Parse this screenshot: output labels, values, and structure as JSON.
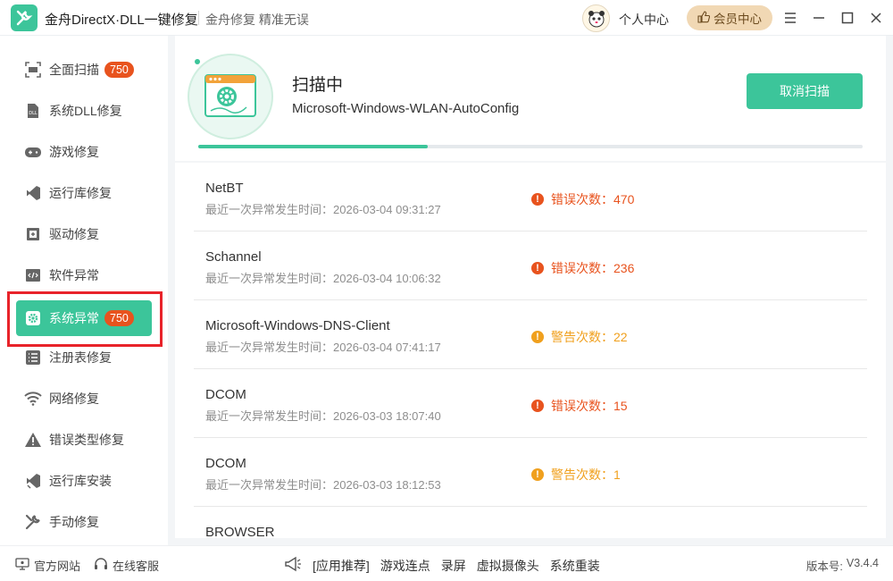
{
  "titlebar": {
    "app_title": "金舟DirectX·DLL一键修复",
    "slogan": "金舟修复 精准无误",
    "personal_center": "个人中心",
    "vip_center": "会员中心"
  },
  "sidebar": {
    "items": [
      {
        "label": "全面扫描",
        "badge": "750",
        "icon": "scan-icon"
      },
      {
        "label": "系统DLL修复",
        "badge": "",
        "icon": "dll-icon"
      },
      {
        "label": "游戏修复",
        "badge": "",
        "icon": "gamepad-icon"
      },
      {
        "label": "运行库修复",
        "badge": "",
        "icon": "runtime-icon"
      },
      {
        "label": "驱动修复",
        "badge": "",
        "icon": "driver-icon"
      },
      {
        "label": "软件异常",
        "badge": "",
        "icon": "code-icon"
      },
      {
        "label": "系统异常",
        "badge": "750",
        "icon": "gear-icon"
      },
      {
        "label": "注册表修复",
        "badge": "",
        "icon": "list-icon"
      },
      {
        "label": "网络修复",
        "badge": "",
        "icon": "wifi-icon"
      },
      {
        "label": "错误类型修复",
        "badge": "",
        "icon": "warning-icon"
      },
      {
        "label": "运行库安装",
        "badge": "",
        "icon": "install-icon"
      },
      {
        "label": "手动修复",
        "badge": "",
        "icon": "tools-icon"
      }
    ]
  },
  "scan": {
    "title": "扫描中",
    "current_item": "Microsoft-Windows-WLAN-AutoConfig",
    "cancel_label": "取消扫描",
    "progress": 0.345
  },
  "events": [
    {
      "name": "NetBT",
      "time": "最近一次异常发生时间：2026-03-04 09:31:27",
      "status": "错误次数：470",
      "type": "error"
    },
    {
      "name": "Schannel",
      "time": "最近一次异常发生时间：2026-03-04 10:06:32",
      "status": "错误次数：236",
      "type": "error"
    },
    {
      "name": "Microsoft-Windows-DNS-Client",
      "time": "最近一次异常发生时间：2026-03-04 07:41:17",
      "status": "警告次数：22",
      "type": "warning"
    },
    {
      "name": "DCOM",
      "time": "最近一次异常发生时间：2026-03-03 18:07:40",
      "status": "错误次数：15",
      "type": "error"
    },
    {
      "name": "DCOM",
      "time": "最近一次异常发生时间：2026-03-03 18:12:53",
      "status": "警告次数：1",
      "type": "warning"
    },
    {
      "name": "BROWSER",
      "time": "",
      "status": "",
      "type": ""
    }
  ],
  "footer": {
    "official_site": "官方网站",
    "online_service": "在线客服",
    "recommend": "[应用推荐]",
    "links": [
      "游戏连点",
      "录屏",
      "虚拟摄像头",
      "系统重装"
    ],
    "version_label": "版本号:",
    "version": "V3.4.4"
  },
  "colors": {
    "accent": "#3cc59a",
    "error": "#e8531e",
    "warning": "#f0a01e",
    "highlight": "#e8232a",
    "vip_bg": "#f1d8b4"
  }
}
